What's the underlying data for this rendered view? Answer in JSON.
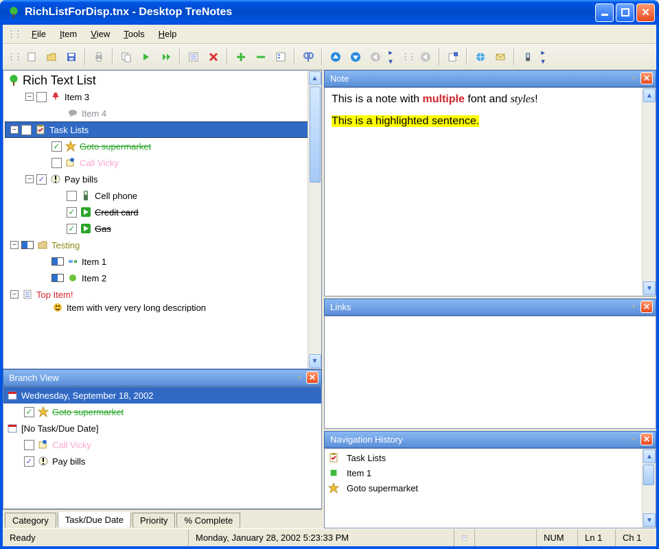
{
  "window": {
    "title": "RichListForDisp.tnx - Desktop TreNotes"
  },
  "menu": {
    "items": [
      "File",
      "Item",
      "View",
      "Tools",
      "Help"
    ]
  },
  "tree": {
    "root_label": "Rich Text List",
    "items": [
      {
        "indent": 1,
        "expander": "-",
        "checkbox": "empty",
        "icon": "pushpin-icon",
        "icon_color": "#d8343a",
        "label": "Item 3",
        "label_class": ""
      },
      {
        "indent": 3,
        "expander": "",
        "checkbox": "",
        "icon": "speech-icon",
        "icon_color": "#aaaaaa",
        "label": "Item 4",
        "label_class": "c-gray"
      },
      {
        "indent": 0,
        "expander": "-",
        "checkbox": "empty",
        "icon": "clipboard-check-icon",
        "icon_color": "#e6b84c",
        "label": "Task Lists",
        "label_class": "",
        "selected": true
      },
      {
        "indent": 2,
        "expander": "",
        "checkbox": "checked",
        "icon": "star-icon",
        "icon_color": "#f2c038",
        "label": "Goto supermarket",
        "label_class": "c-green strikethrough"
      },
      {
        "indent": 2,
        "expander": "",
        "checkbox": "empty",
        "icon": "pin-note-icon",
        "icon_color": "#d69a2c",
        "label": "Call Vicky",
        "label_class": "c-pink"
      },
      {
        "indent": 1,
        "expander": "-",
        "checkbox": "partial",
        "icon": "exclaim-icon",
        "icon_color": "#000",
        "label": "Pay bills",
        "label_class": ""
      },
      {
        "indent": 3,
        "expander": "",
        "checkbox": "empty",
        "icon": "phone-icon",
        "icon_color": "#4f7a4f",
        "label": "Cell phone",
        "label_class": ""
      },
      {
        "indent": 3,
        "expander": "",
        "checkbox": "checked",
        "icon": "arrow-right-icon",
        "icon_color": "#2aa52a",
        "label": "Credit card",
        "label_class": "strikethrough"
      },
      {
        "indent": 3,
        "expander": "",
        "checkbox": "checked",
        "icon": "arrow-right-icon",
        "icon_color": "#2aa52a",
        "label": "Gas",
        "label_class": "strikethrough"
      },
      {
        "indent": 0,
        "expander": "-",
        "checkbox": "progress",
        "icon": "folder-icon",
        "icon_color": "#e6cf8e",
        "label": "Testing",
        "label_class": "c-olive"
      },
      {
        "indent": 2,
        "expander": "",
        "checkbox": "progress",
        "icon": "node-green-icon",
        "icon_color": "#51b351",
        "label": "Item 1",
        "label_class": ""
      },
      {
        "indent": 2,
        "expander": "",
        "checkbox": "progress",
        "icon": "circle-green-icon",
        "icon_color": "#6bc43a",
        "label": "Item 2",
        "label_class": ""
      },
      {
        "indent": 0,
        "expander": "-",
        "checkbox": "",
        "icon": "page-lines-icon",
        "icon_color": "#5b7ad1",
        "label": "Top Item!",
        "label_class": "c-red"
      },
      {
        "indent": 2,
        "expander": "",
        "checkbox": "",
        "icon": "smiley-icon",
        "icon_color": "#f2c038",
        "label": "Item with very very long description",
        "label_class": "",
        "cut": true
      }
    ]
  },
  "branch_view": {
    "header": "Branch View",
    "groups": [
      {
        "icon": "calendar-icon",
        "label": "Wednesday, September 18, 2002",
        "selected": true
      },
      {
        "indent": 1,
        "checkbox": "checked",
        "icon": "star-icon",
        "icon_color": "#f2c038",
        "label": "Goto supermarket",
        "label_class": "c-green strikethrough"
      },
      {
        "icon": "calendar-icon",
        "label": "[No Task/Due Date]"
      },
      {
        "indent": 1,
        "checkbox": "empty",
        "icon": "pin-note-icon",
        "icon_color": "#d69a2c",
        "label": "Call Vicky",
        "label_class": "c-pink"
      },
      {
        "indent": 1,
        "checkbox": "partial",
        "icon": "exclaim-icon",
        "icon_color": "#000",
        "label": "Pay bills",
        "label_class": ""
      }
    ],
    "tabs": [
      "Category",
      "Task/Due Date",
      "Priority",
      "% Complete"
    ],
    "active_tab": 1
  },
  "note_panel": {
    "header": "Note",
    "line1_a": "This is a note with ",
    "line1_b": "multiple",
    "line1_c": " font and ",
    "line1_d": "styles",
    "line1_e": "!",
    "line2": "This is a highlighted sentence."
  },
  "links_panel": {
    "header": "Links"
  },
  "nav_panel": {
    "header": "Navigation History",
    "items": [
      {
        "icon": "clipboard-check-icon",
        "label": "Task Lists"
      },
      {
        "icon": "square-green-icon",
        "label": "Item 1"
      },
      {
        "icon": "star-icon",
        "label": "Goto supermarket"
      }
    ]
  },
  "status": {
    "ready": "Ready",
    "date": "Monday, January 28, 2002 5:23:33 PM",
    "num": "NUM",
    "ln": "Ln 1",
    "ch": "Ch 1"
  }
}
